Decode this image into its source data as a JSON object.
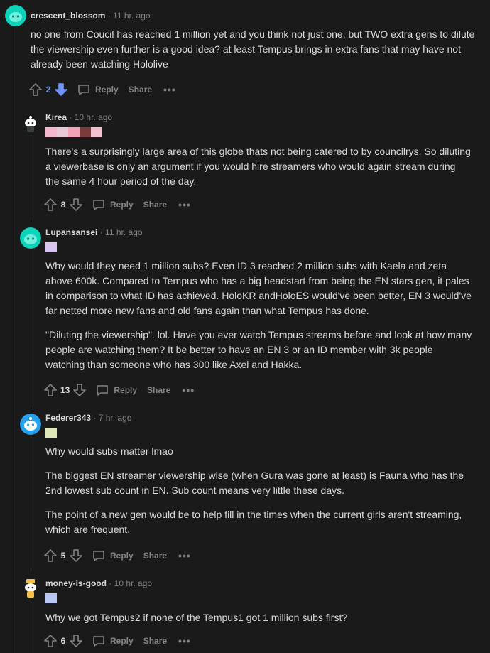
{
  "comments": [
    {
      "user": "crescent_blossom",
      "time": "11 hr. ago",
      "paragraphs": [
        "no one from Coucil has reached 1 million yet and you think not just one, but TWO extra gens to dilute the viewership even further is a good idea? at least Tempus brings in extra fans that may have not already been watching Hololive"
      ],
      "score": "2",
      "reply": "Reply",
      "share": "Share",
      "more": "•••"
    },
    {
      "user": "Kirea",
      "time": "10 hr. ago",
      "paragraphs": [
        "There's a surprisingly large area of this globe thats not being catered to by councilrys. So diluting a viewerbase is only an argument if you would hire streamers who would again stream during the same 4 hour period of the day."
      ],
      "score": "8",
      "reply": "Reply",
      "share": "Share",
      "more": "•••"
    },
    {
      "user": "Lupansansei",
      "time": "11 hr. ago",
      "paragraphs": [
        "Why would they need 1 million subs? Even ID 3 reached 2 million subs with Kaela and zeta above 600k. Compared to Tempus who has a big headstart from being the EN stars gen, it pales in comparison to what ID has achieved. HoloKR andHoloES would've been better, EN 3 would've far netted more new fans and old fans again than what Tempus has done.",
        "\"Diluting the viewership\". lol. Have you ever watch Tempus streams before and look at how many people are watching them? It be better to have an EN 3 or an ID member with 3k people watching than someone who has 300 like Axel and Hakka."
      ],
      "score": "13",
      "reply": "Reply",
      "share": "Share",
      "more": "•••"
    },
    {
      "user": "Federer343",
      "time": "7 hr. ago",
      "paragraphs": [
        "Why would subs matter lmao",
        "The biggest EN streamer viewership wise (when Gura was gone at least) is Fauna who has the 2nd lowest sub count in EN. Sub count means very little these days.",
        "The point of a new gen would be to help fill in the times when the current girls aren't streaming, which are frequent."
      ],
      "score": "5",
      "reply": "Reply",
      "share": "Share",
      "more": "•••"
    },
    {
      "user": "money-is-good",
      "time": "10 hr. ago",
      "paragraphs": [
        "Why we got Tempus2 if none of the Tempus1 got 1 million subs first?"
      ],
      "score": "6",
      "reply": "Reply",
      "share": "Share",
      "more": "•••"
    }
  ],
  "colors": {
    "background": "#1a1a1b",
    "text": "#d7dadc",
    "muted": "#818384",
    "upvote_active": "#7193ff",
    "thread_line": "#343536"
  }
}
